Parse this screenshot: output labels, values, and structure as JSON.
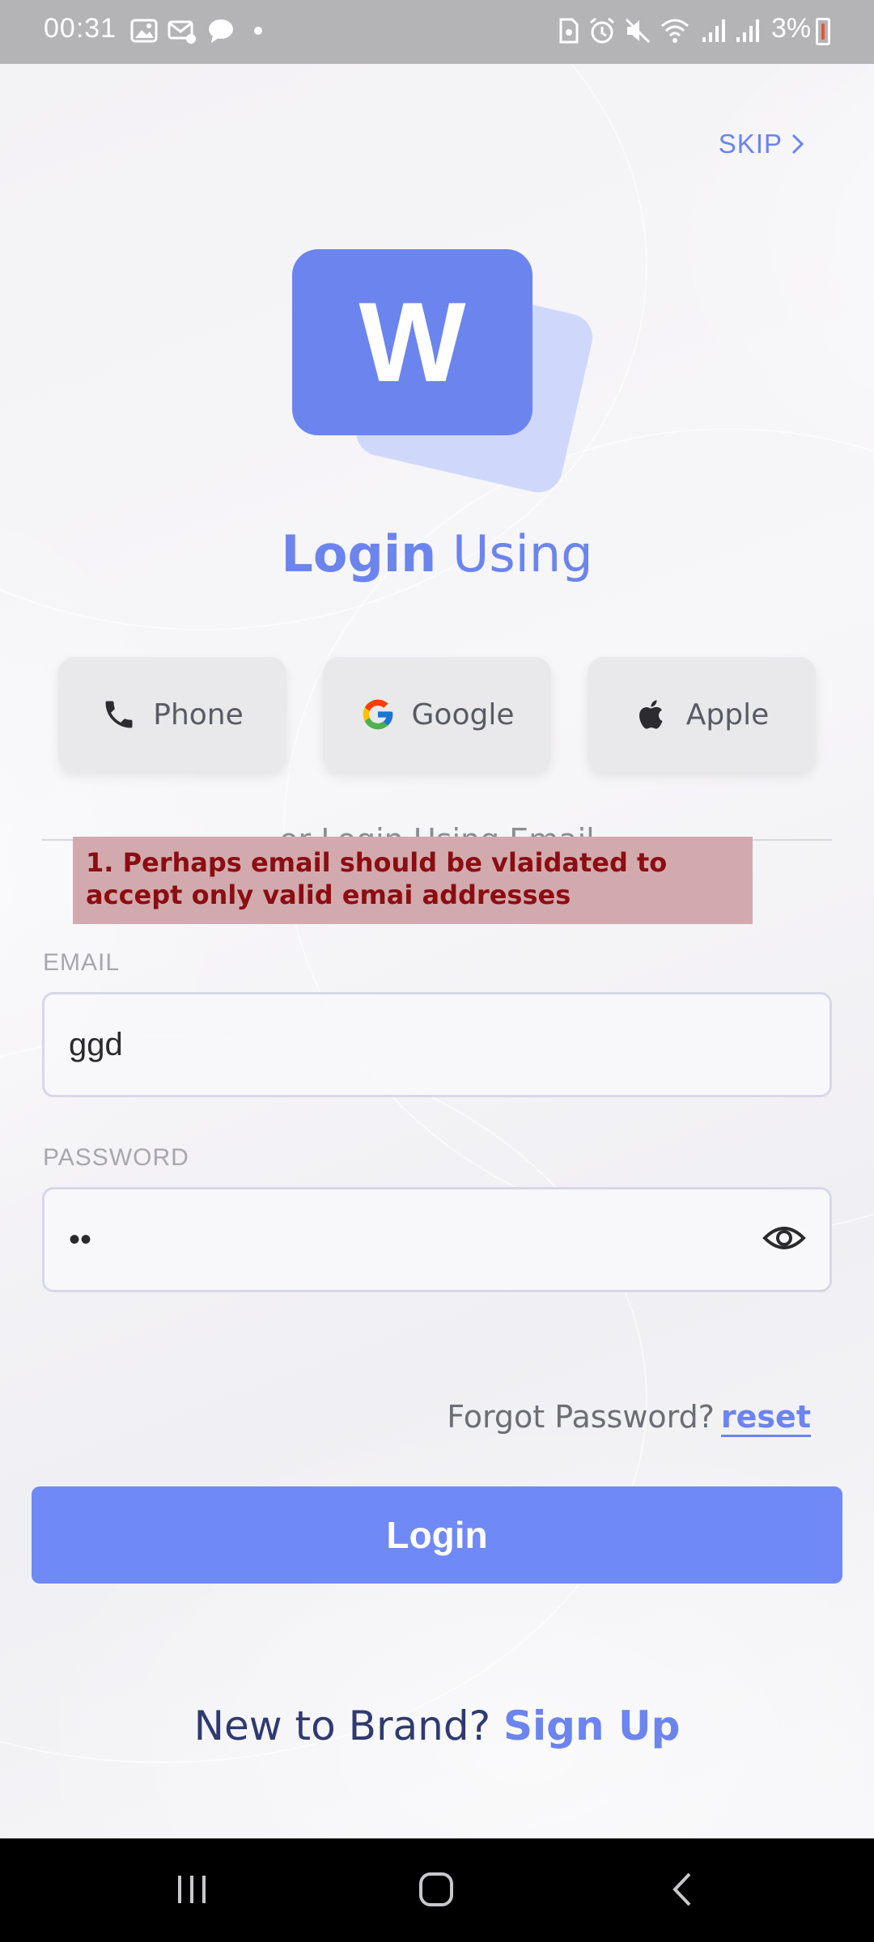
{
  "status_bar": {
    "time": "00:31",
    "battery": "3%",
    "icons": [
      "gallery-icon",
      "mail-settings-icon",
      "chat-icon",
      "dot-icon",
      "sim-icon",
      "alarm-icon",
      "mute-icon",
      "wifi-icon",
      "signal-icon",
      "signal-icon",
      "battery-icon"
    ]
  },
  "skip": {
    "label": "SKIP"
  },
  "logo": {
    "letter": "W"
  },
  "title": {
    "bold": "Login",
    "rest": " Using"
  },
  "social": [
    {
      "label": "Phone",
      "icon": "phone-icon"
    },
    {
      "label": "Google",
      "icon": "google-icon"
    },
    {
      "label": "Apple",
      "icon": "apple-icon"
    }
  ],
  "divider_text": "or Login Using Email",
  "annotation": "1. Perhaps email should be vlaidated to accept only valid emai addresses",
  "email": {
    "label": "EMAIL",
    "value": "ggd"
  },
  "password": {
    "label": "PASSWORD",
    "value": "••"
  },
  "forgot": {
    "text": "Forgot Password?",
    "link": "reset"
  },
  "login_button": "Login",
  "signup": {
    "text": "New to Brand?",
    "link": "Sign Up"
  },
  "colors": {
    "accent": "#6b84ee",
    "annotation_bg": "#d2aaad",
    "annotation_text": "#8b0d12"
  }
}
